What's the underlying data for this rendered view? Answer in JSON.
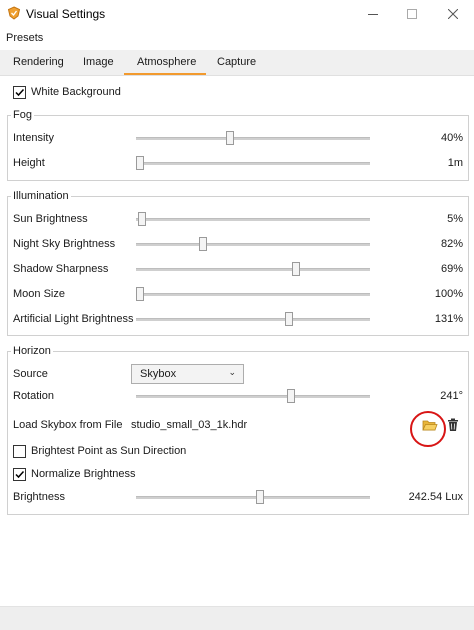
{
  "window": {
    "title": "Visual Settings"
  },
  "presets_label": "Presets",
  "tabs": [
    {
      "label": "Rendering"
    },
    {
      "label": "Image"
    },
    {
      "label": "Atmosphere",
      "active": true
    },
    {
      "label": "Capture"
    }
  ],
  "white_background": {
    "label": "White Background",
    "checked": true
  },
  "fog": {
    "title": "Fog",
    "rows": [
      {
        "label": "Intensity",
        "value": "40%",
        "level": 0.4
      },
      {
        "label": "Height",
        "value": "1m",
        "level": 0.0
      }
    ]
  },
  "illumination": {
    "title": "Illumination",
    "rows": [
      {
        "label": "Sun Brightness",
        "value": "5%",
        "level": 0.01
      },
      {
        "label": "Night Sky Brightness",
        "value": "82%",
        "level": 0.28
      },
      {
        "label": "Shadow Sharpness",
        "value": "69%",
        "level": 0.69
      },
      {
        "label": "Moon Size",
        "value": "100%",
        "level": 0.0
      },
      {
        "label": "Artificial Light Brightness",
        "value": "131%",
        "level": 0.66
      }
    ]
  },
  "horizon": {
    "title": "Horizon",
    "source_label": "Source",
    "source_value": "Skybox",
    "rotation": {
      "label": "Rotation",
      "value": "241°",
      "level": 0.67
    },
    "load_skybox_label": "Load Skybox from File",
    "skybox_file": "studio_small_03_1k.hdr",
    "brightest_point": {
      "label": "Brightest Point as Sun Direction",
      "checked": false
    },
    "normalize": {
      "label": "Normalize Brightness",
      "checked": true
    },
    "brightness": {
      "label": "Brightness",
      "value": "242.54 Lux",
      "level": 0.53
    }
  },
  "colors": {
    "accent": "#f29a2e",
    "highlight": "#d81515"
  },
  "icons": [
    "app-logo-icon",
    "minimize-icon",
    "maximize-icon",
    "close-icon",
    "folder-open-icon",
    "trash-icon",
    "checkmark-icon",
    "chevron-down-icon"
  ]
}
